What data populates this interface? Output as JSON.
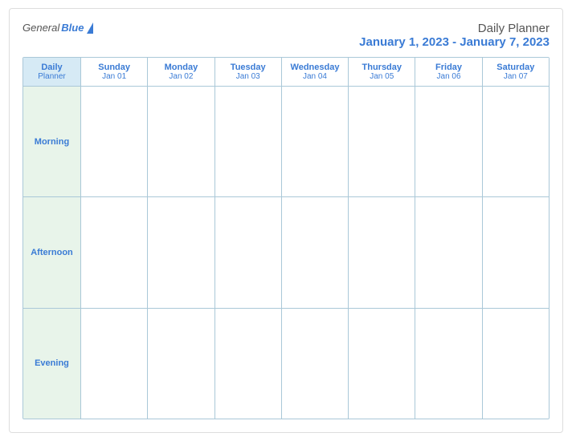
{
  "header": {
    "logo_general": "General",
    "logo_blue": "Blue",
    "title": "Daily Planner",
    "dates": "January 1, 2023 - January 7, 2023"
  },
  "calendar": {
    "label_main": "Daily",
    "label_sub": "Planner",
    "days": [
      {
        "name": "Sunday",
        "date": "Jan 01"
      },
      {
        "name": "Monday",
        "date": "Jan 02"
      },
      {
        "name": "Tuesday",
        "date": "Jan 03"
      },
      {
        "name": "Wednesday",
        "date": "Jan 04"
      },
      {
        "name": "Thursday",
        "date": "Jan 05"
      },
      {
        "name": "Friday",
        "date": "Jan 06"
      },
      {
        "name": "Saturday",
        "date": "Jan 07"
      }
    ],
    "times": [
      "Morning",
      "Afternoon",
      "Evening"
    ]
  }
}
